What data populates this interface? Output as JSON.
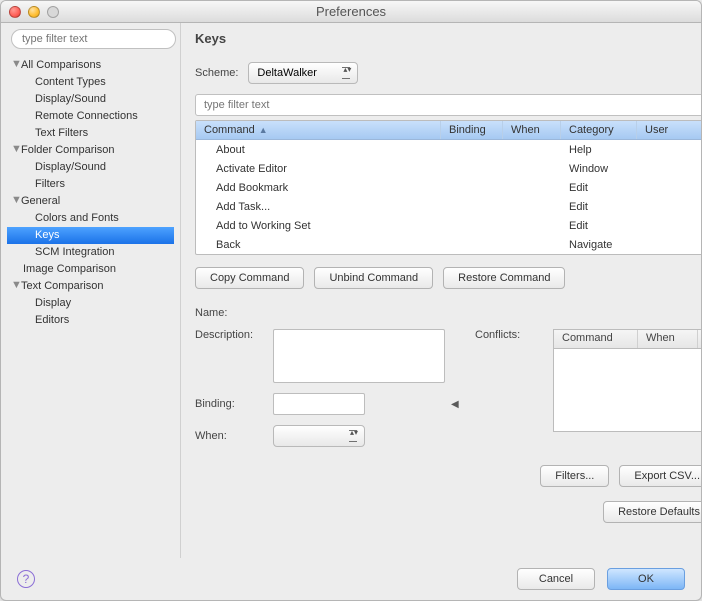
{
  "window": {
    "title": "Preferences"
  },
  "sidebar": {
    "filter_placeholder": "type filter text",
    "nodes": [
      {
        "label": "All Comparisons",
        "level": 1,
        "expandable": true,
        "expanded": true,
        "selected": false
      },
      {
        "label": "Content Types",
        "level": 2,
        "expandable": false,
        "selected": false
      },
      {
        "label": "Display/Sound",
        "level": 2,
        "expandable": false,
        "selected": false
      },
      {
        "label": "Remote Connections",
        "level": 2,
        "expandable": false,
        "selected": false
      },
      {
        "label": "Text Filters",
        "level": 2,
        "expandable": false,
        "selected": false
      },
      {
        "label": "Folder Comparison",
        "level": 1,
        "expandable": true,
        "expanded": true,
        "selected": false
      },
      {
        "label": "Display/Sound",
        "level": 2,
        "expandable": false,
        "selected": false
      },
      {
        "label": "Filters",
        "level": 2,
        "expandable": false,
        "selected": false
      },
      {
        "label": "General",
        "level": 1,
        "expandable": true,
        "expanded": true,
        "selected": false
      },
      {
        "label": "Colors and Fonts",
        "level": 2,
        "expandable": false,
        "selected": false
      },
      {
        "label": "Keys",
        "level": 2,
        "expandable": false,
        "selected": true
      },
      {
        "label": "SCM Integration",
        "level": 2,
        "expandable": false,
        "selected": false
      },
      {
        "label": "Image Comparison",
        "level": 1,
        "expandable": false,
        "noindent": true,
        "selected": false
      },
      {
        "label": "Text Comparison",
        "level": 1,
        "expandable": true,
        "expanded": true,
        "selected": false
      },
      {
        "label": "Display",
        "level": 2,
        "expandable": false,
        "selected": false
      },
      {
        "label": "Editors",
        "level": 2,
        "expandable": false,
        "selected": false
      }
    ]
  },
  "page": {
    "title": "Keys",
    "scheme_label": "Scheme:",
    "scheme_value": "DeltaWalker",
    "cmd_filter_placeholder": "type filter text",
    "columns": {
      "command": "Command",
      "binding": "Binding",
      "when": "When",
      "category": "Category",
      "user": "User"
    },
    "rows": [
      {
        "command": "About",
        "binding": "",
        "when": "",
        "category": "Help",
        "user": ""
      },
      {
        "command": "Activate Editor",
        "binding": "",
        "when": "",
        "category": "Window",
        "user": ""
      },
      {
        "command": "Add Bookmark",
        "binding": "",
        "when": "",
        "category": "Edit",
        "user": ""
      },
      {
        "command": "Add Task...",
        "binding": "",
        "when": "",
        "category": "Edit",
        "user": ""
      },
      {
        "command": "Add to Working Set",
        "binding": "",
        "when": "",
        "category": "Edit",
        "user": ""
      },
      {
        "command": "Back",
        "binding": "",
        "when": "",
        "category": "Navigate",
        "user": ""
      }
    ],
    "btn_copy": "Copy Command",
    "btn_unbind": "Unbind Command",
    "btn_restore_cmd": "Restore Command",
    "name_label": "Name:",
    "desc_label": "Description:",
    "conflicts_label": "Conflicts:",
    "conflicts_cols": {
      "command": "Command",
      "when": "When"
    },
    "binding_label": "Binding:",
    "when_label": "When:",
    "when_value": "",
    "btn_filters": "Filters...",
    "btn_export": "Export CSV...",
    "btn_restore_defaults": "Restore Defaults"
  },
  "footer": {
    "cancel": "Cancel",
    "ok": "OK"
  }
}
